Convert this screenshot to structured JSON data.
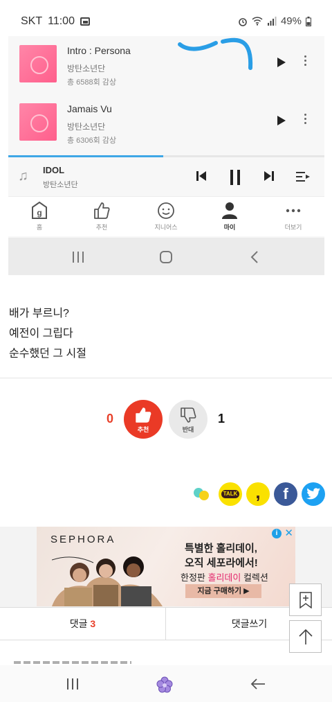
{
  "status_bar": {
    "carrier": "SKT",
    "time": "11:00",
    "battery": "49%",
    "icons": [
      "image-icon",
      "alarm-icon",
      "wifi-icon",
      "signal-icon",
      "battery-icon"
    ]
  },
  "embedded_player": {
    "tracks": [
      {
        "title": "Intro : Persona",
        "artist": "방탄소년단",
        "plays": "총 6588회 감상"
      },
      {
        "title": "Jamais Vu",
        "artist": "방탄소년단",
        "plays": "총 6306회 감상"
      }
    ],
    "progress_fraction": 0.49,
    "now_playing": {
      "title": "IDOL",
      "artist": "방탄소년단"
    },
    "app_tabs": [
      {
        "label": "홈",
        "icon": "home-g-icon"
      },
      {
        "label": "추천",
        "icon": "thumbs-up-icon"
      },
      {
        "label": "지니어스",
        "icon": "smile-icon"
      },
      {
        "label": "마이",
        "icon": "person-icon",
        "active": true
      },
      {
        "label": "더보기",
        "icon": "dots-icon"
      }
    ]
  },
  "post": {
    "lines": [
      "배가 부르니?",
      "예전이 그립다",
      "순수했던 그 시절"
    ]
  },
  "votes": {
    "up_count": "0",
    "up_label": "추천",
    "down_label": "반대",
    "down_count": "1"
  },
  "share": {
    "kakaotalk_label": "TALK",
    "kakaostory_label": ",",
    "facebook_label": "f"
  },
  "ad": {
    "brand": "SEPHORA",
    "headline_1": "특별한 홀리데이,",
    "headline_2": "오직 세포라에서!",
    "sub_prefix": "한정판 ",
    "sub_highlight": "홀리데이",
    "sub_suffix": " 컬렉션",
    "cta": "지금 구매하기 ▶"
  },
  "comments": {
    "tab_label": "댓글",
    "count": "3",
    "write_label": "댓글쓰기"
  },
  "colors": {
    "accent_red": "#e8402a",
    "progress_blue": "#3fa7e6",
    "kakao_yellow": "#fae100",
    "facebook_blue": "#3b5998",
    "twitter_blue": "#1da1f2"
  }
}
